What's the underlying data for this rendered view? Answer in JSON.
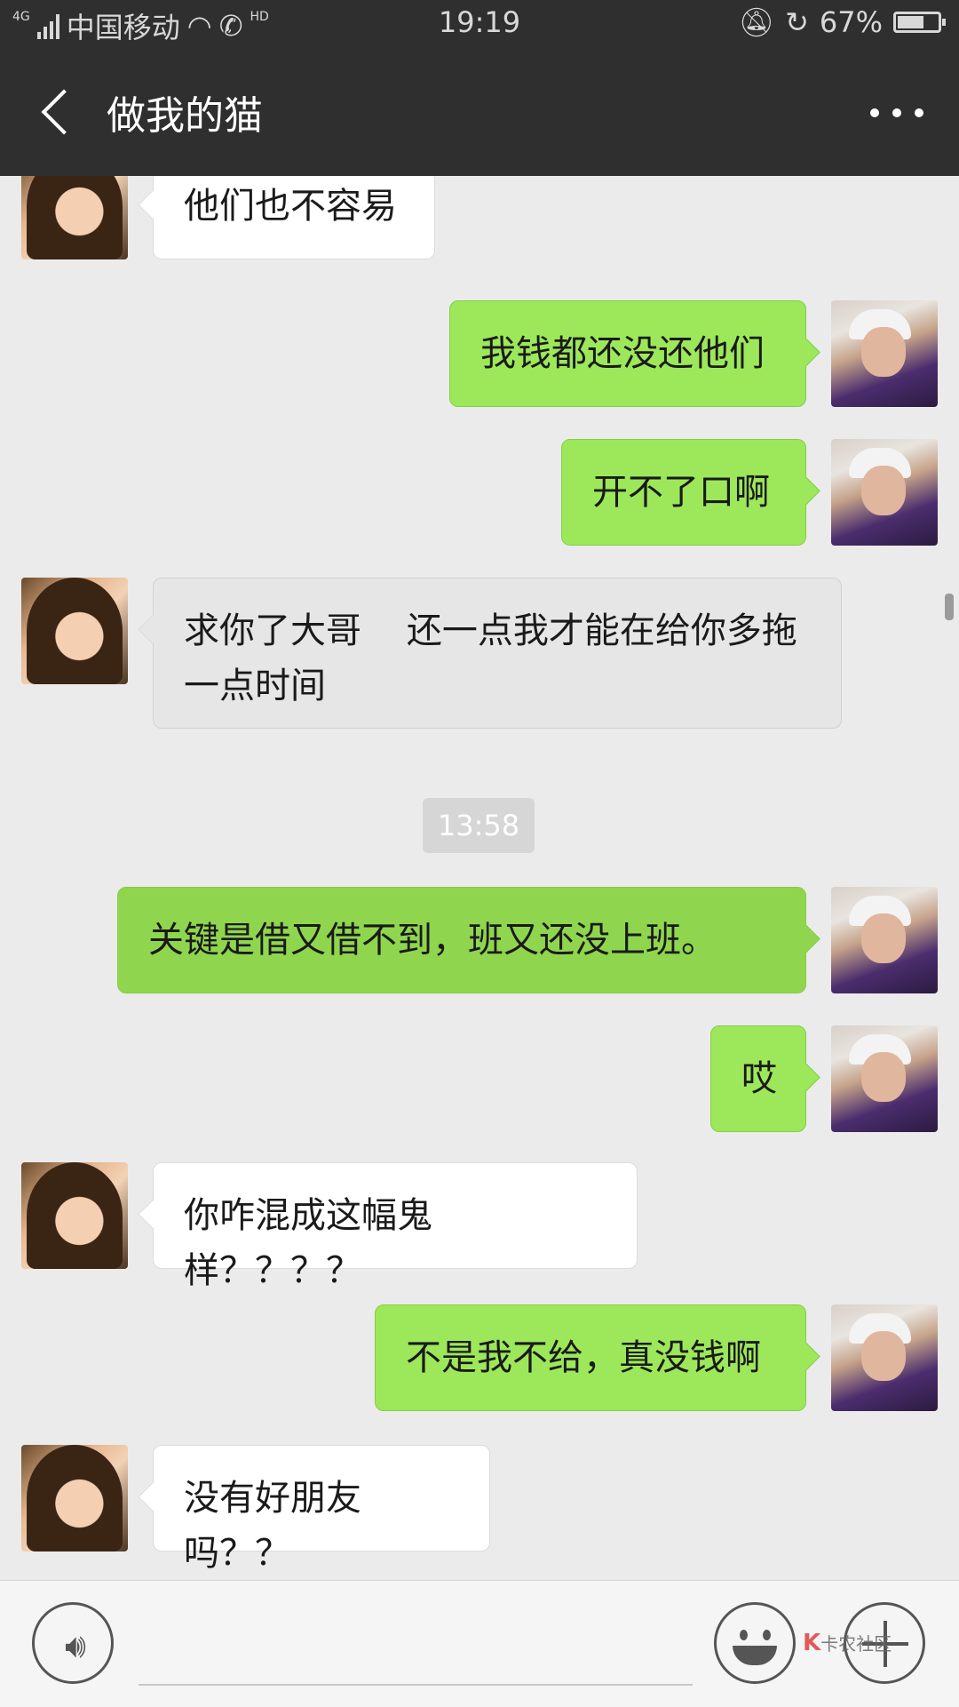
{
  "status_bar": {
    "network": "4G",
    "carrier": "中国移动",
    "hd": "HD",
    "time": "19:19",
    "battery_pct": "67%",
    "battery_level": 0.67
  },
  "header": {
    "title": "做我的猫"
  },
  "messages": [
    {
      "side": "in",
      "text": "他们也不容易"
    },
    {
      "side": "out",
      "text": "我钱都还没还他们"
    },
    {
      "side": "out",
      "text": "开不了口啊"
    },
    {
      "side": "in",
      "text": "求你了大哥    还一点我才能在给你多拖一点时间"
    },
    {
      "side": "out",
      "text": "关键是借又借不到，班又还没上班。"
    },
    {
      "side": "out",
      "text": "哎"
    },
    {
      "side": "in",
      "text": "你咋混成这幅鬼样？？？？"
    },
    {
      "side": "out",
      "text": "不是我不给，真没钱啊"
    },
    {
      "side": "in",
      "text": "没有好朋友吗？？"
    }
  ],
  "timestamp": "13:58",
  "watermark": "卡农社区"
}
